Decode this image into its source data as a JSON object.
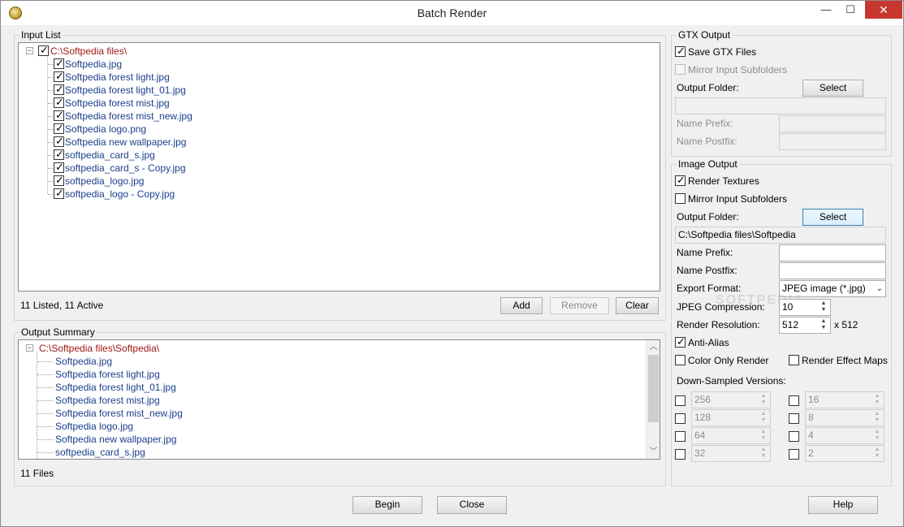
{
  "window": {
    "title": "Batch Render",
    "minimize": "—",
    "maximize": "☐",
    "close": "✕"
  },
  "input_list": {
    "group_label": "Input List",
    "root": "C:\\Softpedia files\\",
    "items": [
      "Softpedia.jpg",
      "Softpedia forest light.jpg",
      "Softpedia forest light_01.jpg",
      "Softpedia forest mist.jpg",
      "Softpedia forest mist_new.jpg",
      "Softpedia logo.png",
      "Softpedia new wallpaper.jpg",
      "softpedia_card_s.jpg",
      "softpedia_card_s - Copy.jpg",
      "softpedia_logo.jpg",
      "softpedia_logo - Copy.jpg"
    ],
    "status": "11 Listed, 11 Active",
    "add_label": "Add",
    "remove_label": "Remove",
    "clear_label": "Clear"
  },
  "output_summary": {
    "group_label": "Output Summary",
    "root": "C:\\Softpedia files\\Softpedia\\",
    "items": [
      "Softpedia.jpg",
      "Softpedia forest light.jpg",
      "Softpedia forest light_01.jpg",
      "Softpedia forest mist.jpg",
      "Softpedia forest mist_new.jpg",
      "Softpedia logo.jpg",
      "Softpedia new wallpaper.jpg",
      "softpedia_card_s.jpg"
    ],
    "status": "11 Files"
  },
  "gtx_output": {
    "group_label": "GTX Output",
    "save_gtx": "Save GTX Files",
    "mirror": "Mirror Input Subfolders",
    "output_folder": "Output Folder:",
    "select": "Select",
    "folder_value": "",
    "name_prefix": "Name Prefix:",
    "name_postfix": "Name Postfix:"
  },
  "image_output": {
    "group_label": "Image Output",
    "render_textures": "Render Textures",
    "mirror": "Mirror Input Subfolders",
    "output_folder": "Output Folder:",
    "select": "Select",
    "folder_value": "C:\\Softpedia files\\Softpedia",
    "name_prefix": "Name Prefix:",
    "name_postfix": "Name Postfix:",
    "export_format": "Export Format:",
    "export_format_value": "JPEG image (*.jpg)",
    "jpeg_compression": "JPEG Compression:",
    "jpeg_compression_value": "10",
    "render_resolution": "Render Resolution:",
    "render_resolution_value": "512",
    "resolution_suffix": "x 512",
    "anti_alias": "Anti-Alias",
    "color_only": "Color Only Render",
    "render_effect_maps": "Render Effect Maps",
    "down_sampled": "Down-Sampled Versions:",
    "down_left": [
      "256",
      "128",
      "64",
      "32"
    ],
    "down_right": [
      "16",
      "8",
      "4",
      "2"
    ]
  },
  "footer": {
    "begin": "Begin",
    "close": "Close",
    "help": "Help"
  },
  "watermark": "SOFTPEDIA"
}
